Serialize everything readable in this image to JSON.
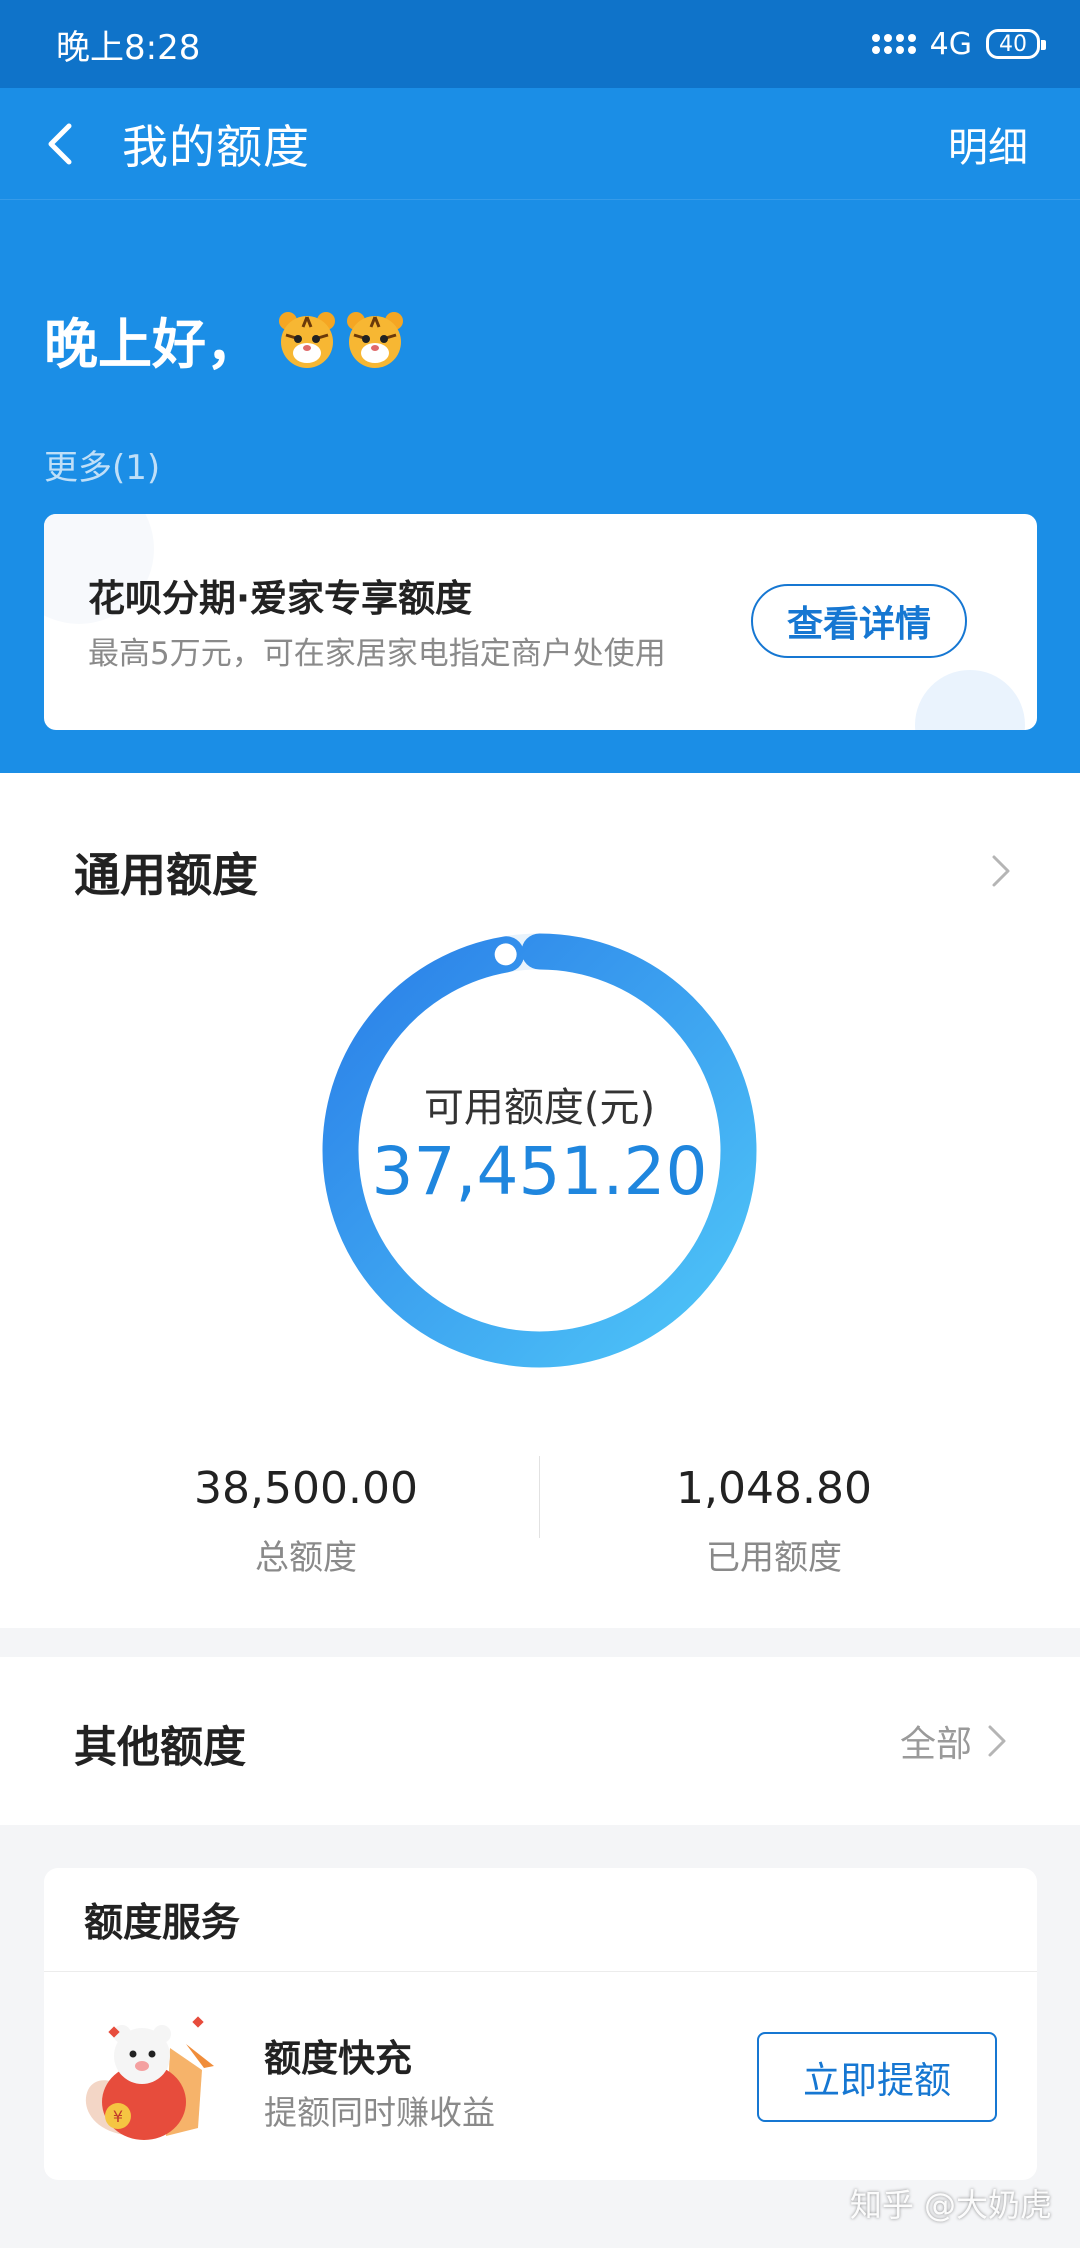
{
  "status_bar": {
    "time": "晚上8:28",
    "network": "4G",
    "battery": "40"
  },
  "header": {
    "title": "我的额度",
    "detail_label": "明细"
  },
  "greeting": {
    "text": "晚上好，"
  },
  "more": {
    "label": "更多",
    "count": "(1)"
  },
  "promo": {
    "title": "花呗分期·爱家专享额度",
    "subtitle": "最高5万元，可在家居家电指定商户处使用",
    "button_label": "查看详情"
  },
  "general": {
    "title": "通用额度",
    "available_label": "可用额度(元)",
    "available_value": "37,451.20",
    "total_value": "38,500.00",
    "total_label": "总额度",
    "used_value": "1,048.80",
    "used_label": "已用额度",
    "available_fraction": 0.9728
  },
  "other": {
    "title": "其他额度",
    "all_label": "全部"
  },
  "service": {
    "title": "额度服务",
    "item_name": "额度快充",
    "item_sub": "提额同时赚收益",
    "button_label": "立即提额"
  },
  "watermark": "知乎 @大奶虎",
  "colors": {
    "header_blue": "#1b8ee6",
    "status_blue": "#0f73c9",
    "accent": "#1677d2",
    "value_blue": "#1f86de"
  },
  "icons": [
    "back-arrow-icon",
    "tiger-emoji-icon",
    "chevron-right-icon",
    "mascot-icon"
  ]
}
